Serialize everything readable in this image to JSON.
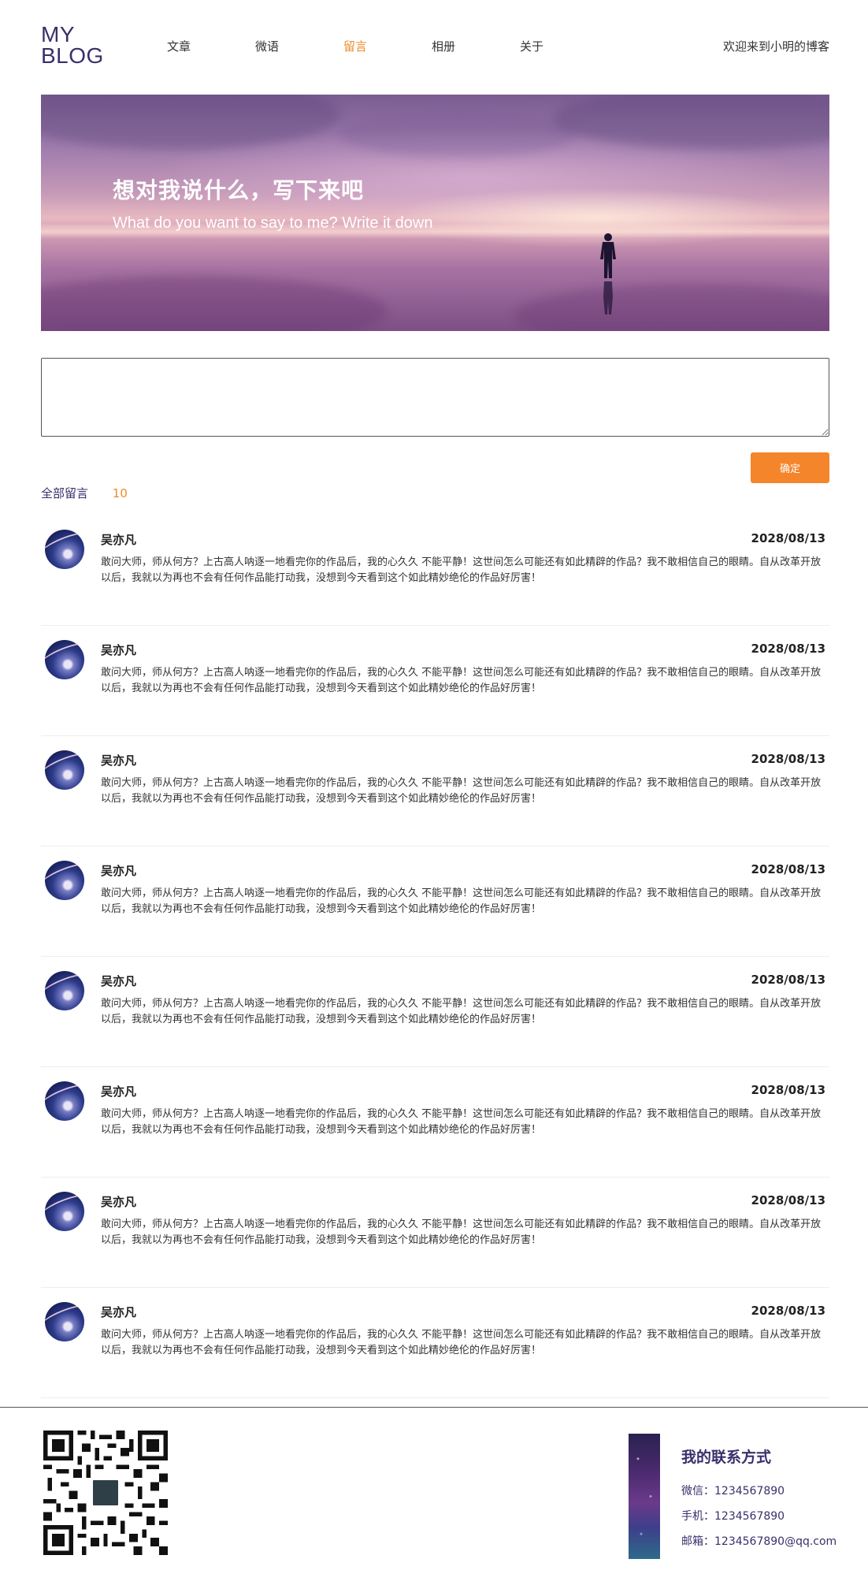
{
  "logo": {
    "line1": "MY",
    "line2": "BLOG"
  },
  "nav": [
    {
      "label": "文章",
      "active": false
    },
    {
      "label": "微语",
      "active": false
    },
    {
      "label": "留言",
      "active": true
    },
    {
      "label": "相册",
      "active": false
    },
    {
      "label": "关于",
      "active": false
    }
  ],
  "header": {
    "welcome": "欢迎来到小明的博客"
  },
  "banner": {
    "title": "想对我说什么，写下来吧",
    "subtitle": "What do you want to say to me? Write it down"
  },
  "form": {
    "textarea_value": "",
    "confirm_label": "确定"
  },
  "messages": {
    "count_label": "全部留言",
    "count": "10",
    "items": [
      {
        "name": "吴亦凡",
        "date": "2028/08/13",
        "content": "敢问大师，师从何方？上古高人呐逐一地看完你的作品后，我的心久久 不能平静！这世间怎么可能还有如此精辟的作品？我不敢相信自己的眼睛。自从改革开放以后，我就以为再也不会有任何作品能打动我，没想到今天看到这个如此精妙绝伦的作品好厉害！"
      },
      {
        "name": "吴亦凡",
        "date": "2028/08/13",
        "content": "敢问大师，师从何方？上古高人呐逐一地看完你的作品后，我的心久久 不能平静！这世间怎么可能还有如此精辟的作品？我不敢相信自己的眼睛。自从改革开放以后，我就以为再也不会有任何作品能打动我，没想到今天看到这个如此精妙绝伦的作品好厉害！"
      },
      {
        "name": "吴亦凡",
        "date": "2028/08/13",
        "content": "敢问大师，师从何方？上古高人呐逐一地看完你的作品后，我的心久久 不能平静！这世间怎么可能还有如此精辟的作品？我不敢相信自己的眼睛。自从改革开放以后，我就以为再也不会有任何作品能打动我，没想到今天看到这个如此精妙绝伦的作品好厉害！"
      },
      {
        "name": "吴亦凡",
        "date": "2028/08/13",
        "content": "敢问大师，师从何方？上古高人呐逐一地看完你的作品后，我的心久久 不能平静！这世间怎么可能还有如此精辟的作品？我不敢相信自己的眼睛。自从改革开放以后，我就以为再也不会有任何作品能打动我，没想到今天看到这个如此精妙绝伦的作品好厉害！"
      },
      {
        "name": "吴亦凡",
        "date": "2028/08/13",
        "content": "敢问大师，师从何方？上古高人呐逐一地看完你的作品后，我的心久久 不能平静！这世间怎么可能还有如此精辟的作品？我不敢相信自己的眼睛。自从改革开放以后，我就以为再也不会有任何作品能打动我，没想到今天看到这个如此精妙绝伦的作品好厉害！"
      },
      {
        "name": "吴亦凡",
        "date": "2028/08/13",
        "content": "敢问大师，师从何方？上古高人呐逐一地看完你的作品后，我的心久久 不能平静！这世间怎么可能还有如此精辟的作品？我不敢相信自己的眼睛。自从改革开放以后，我就以为再也不会有任何作品能打动我，没想到今天看到这个如此精妙绝伦的作品好厉害！"
      },
      {
        "name": "吴亦凡",
        "date": "2028/08/13",
        "content": "敢问大师，师从何方？上古高人呐逐一地看完你的作品后，我的心久久 不能平静！这世间怎么可能还有如此精辟的作品？我不敢相信自己的眼睛。自从改革开放以后，我就以为再也不会有任何作品能打动我，没想到今天看到这个如此精妙绝伦的作品好厉害！"
      },
      {
        "name": "吴亦凡",
        "date": "2028/08/13",
        "content": "敢问大师，师从何方？上古高人呐逐一地看完你的作品后，我的心久久 不能平静！这世间怎么可能还有如此精辟的作品？我不敢相信自己的眼睛。自从改革开放以后，我就以为再也不会有任何作品能打动我，没想到今天看到这个如此精妙绝伦的作品好厉害！"
      }
    ]
  },
  "footer": {
    "contact_title": "我的联系方式",
    "wechat": "微信：1234567890",
    "phone": "手机：1234567890",
    "email": "邮箱：1234567890@qq.com"
  },
  "colors": {
    "accent": "#f5852b",
    "brand": "#3a2f6b"
  },
  "icons": {
    "qr": "qr-code-icon",
    "avatar": "avatar-image",
    "contact_image": "galaxy-image"
  }
}
